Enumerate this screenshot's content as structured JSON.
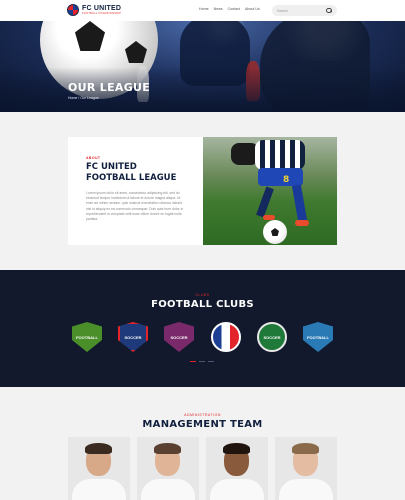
{
  "brand": {
    "title": "FC UNITED",
    "subtitle": "FOOTBALL CHAMPIONSHIP"
  },
  "nav": {
    "items": [
      "Home",
      "News",
      "Contact",
      "About Us"
    ]
  },
  "search": {
    "placeholder": "Search"
  },
  "hero": {
    "title": "OUR LEAGUE",
    "breadcrumb": "Home / Our League"
  },
  "about": {
    "kicker": "ABOUT",
    "title_line1": "FC UNITED",
    "title_line2": "FOOTBALL LEAGUE",
    "body": "Lorem ipsum dolor sit amet, consectetur adipiscing elit, sed do eiusmod tempor incididunt ut labore et dolore magna aliqua. Ut enim ad minim veniam, quis nostrud exercitation ullamco laboris nisi ut aliquip ex ea commodo consequat. Duis aute irure dolor in reprehenderit in voluptate velit esse cillum dolore eu fugiat nulla pariatur."
  },
  "clubs": {
    "kicker": "CLUBS",
    "title": "FOOTBALL CLUBS",
    "crests": [
      {
        "label": "FOOTBALL",
        "color": "#4a8f2a"
      },
      {
        "label": "SOCCER",
        "color": "#1e3a7a"
      },
      {
        "label": "SOCCER",
        "color": "#7a2a6a"
      },
      {
        "label": "",
        "color": "#ffffff"
      },
      {
        "label": "SOCCER",
        "color": "#1f7a3a"
      },
      {
        "label": "FOOTBALL",
        "color": "#2a7ab5"
      }
    ],
    "slider_pages": 3,
    "active_page": 1
  },
  "management": {
    "kicker": "ADMINISTRATION",
    "title": "MANAGEMENT TEAM"
  },
  "colors": {
    "accent": "#e3242b",
    "navy": "#12203f"
  }
}
